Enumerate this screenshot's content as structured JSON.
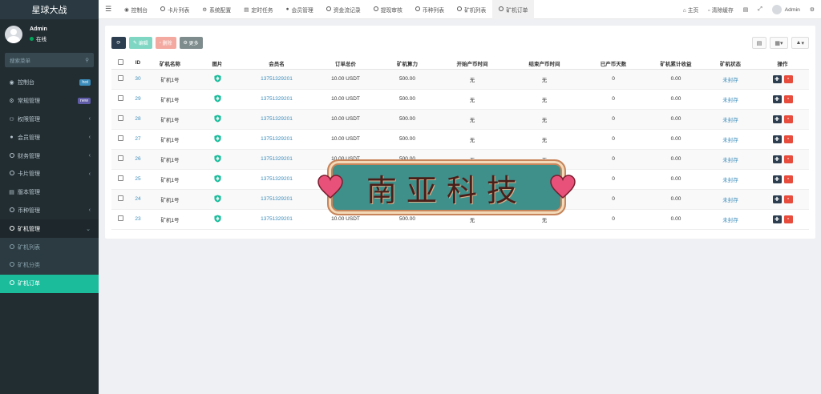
{
  "app": {
    "title": "星球大战"
  },
  "user": {
    "name": "Admin",
    "status": "在线"
  },
  "search": {
    "placeholder": "搜索菜单"
  },
  "sidebar": {
    "items": [
      {
        "label": "控制台",
        "icon": "dashboard-icon",
        "badge": "hot"
      },
      {
        "label": "常规管理",
        "icon": "cogs-icon",
        "badge": "new"
      },
      {
        "label": "权限管理",
        "icon": "group-icon",
        "chevron": "‹"
      },
      {
        "label": "会员管理",
        "icon": "user-icon",
        "chevron": "‹"
      },
      {
        "label": "财务管理",
        "icon": "circle-icon",
        "chevron": "‹"
      },
      {
        "label": "卡片管理",
        "icon": "circle-icon",
        "chevron": "‹"
      },
      {
        "label": "版本管理",
        "icon": "file-icon"
      },
      {
        "label": "币种管理",
        "icon": "circle-icon",
        "chevron": "‹"
      },
      {
        "label": "矿机管理",
        "icon": "circle-icon",
        "chevron": "⌄"
      }
    ],
    "subitems": [
      {
        "label": "矿机列表"
      },
      {
        "label": "矿机分类"
      },
      {
        "label": "矿机订单"
      }
    ]
  },
  "topnav": {
    "tabs": [
      {
        "label": "控制台",
        "icon": "dashboard-icon"
      },
      {
        "label": "卡片列表",
        "icon": "circle-icon"
      },
      {
        "label": "系统配置",
        "icon": "gear-icon"
      },
      {
        "label": "定时任务",
        "icon": "tasks-icon"
      },
      {
        "label": "会员管理",
        "icon": "user-icon"
      },
      {
        "label": "资金流记录",
        "icon": "circle-icon"
      },
      {
        "label": "提现审核",
        "icon": "circle-icon"
      },
      {
        "label": "币种列表",
        "icon": "circle-icon"
      },
      {
        "label": "矿机列表",
        "icon": "circle-icon"
      },
      {
        "label": "矿机订单",
        "icon": "circle-icon"
      }
    ],
    "home": "主页",
    "clear_cache": "清除缓存",
    "admin": "Admin"
  },
  "toolbar": {
    "edit": "编辑",
    "delete": "删除",
    "more": "更多"
  },
  "table": {
    "headers": [
      "ID",
      "矿机名称",
      "图片",
      "会员名",
      "订单总价",
      "矿机算力",
      "开始产币时间",
      "结束产币时间",
      "已产币天数",
      "矿机累计收益",
      "矿机状态",
      "操作"
    ],
    "rows": [
      {
        "id": "30",
        "name": "矿机1号",
        "member": "13751329201",
        "price": "10.00 USDT",
        "power": "500.00",
        "start": "无",
        "end": "无",
        "days": "0",
        "income": "0.00",
        "status": "未封存"
      },
      {
        "id": "29",
        "name": "矿机1号",
        "member": "13751329201",
        "price": "10.00 USDT",
        "power": "500.00",
        "start": "无",
        "end": "无",
        "days": "0",
        "income": "0.00",
        "status": "未封存"
      },
      {
        "id": "28",
        "name": "矿机1号",
        "member": "13751329201",
        "price": "10.00 USDT",
        "power": "500.00",
        "start": "无",
        "end": "无",
        "days": "0",
        "income": "0.00",
        "status": "未封存"
      },
      {
        "id": "27",
        "name": "矿机1号",
        "member": "13751329201",
        "price": "10.00 USDT",
        "power": "500.00",
        "start": "无",
        "end": "无",
        "days": "0",
        "income": "0.00",
        "status": "未封存"
      },
      {
        "id": "26",
        "name": "矿机1号",
        "member": "13751329201",
        "price": "10.00 USDT",
        "power": "500.00",
        "start": "无",
        "end": "无",
        "days": "0",
        "income": "0.00",
        "status": "未封存"
      },
      {
        "id": "25",
        "name": "矿机1号",
        "member": "13751329201",
        "price": "10.00 USDT",
        "power": "500.00",
        "start": "无",
        "end": "无",
        "days": "0",
        "income": "0.00",
        "status": "未封存"
      },
      {
        "id": "24",
        "name": "矿机1号",
        "member": "13751329201",
        "price": "10.00 USDT",
        "power": "500.00",
        "start": "无",
        "end": "无",
        "days": "0",
        "income": "0.00",
        "status": "未封存"
      },
      {
        "id": "23",
        "name": "矿机1号",
        "member": "13751329201",
        "price": "10.00 USDT",
        "power": "500.00",
        "start": "无",
        "end": "无",
        "days": "0",
        "income": "0.00",
        "status": "未封存"
      }
    ]
  },
  "watermark": {
    "text": "南亚科技"
  },
  "colors": {
    "accent": "#1abc9c",
    "sidebar": "#222d32",
    "link": "#3c8dbc",
    "danger": "#e74c3c"
  }
}
